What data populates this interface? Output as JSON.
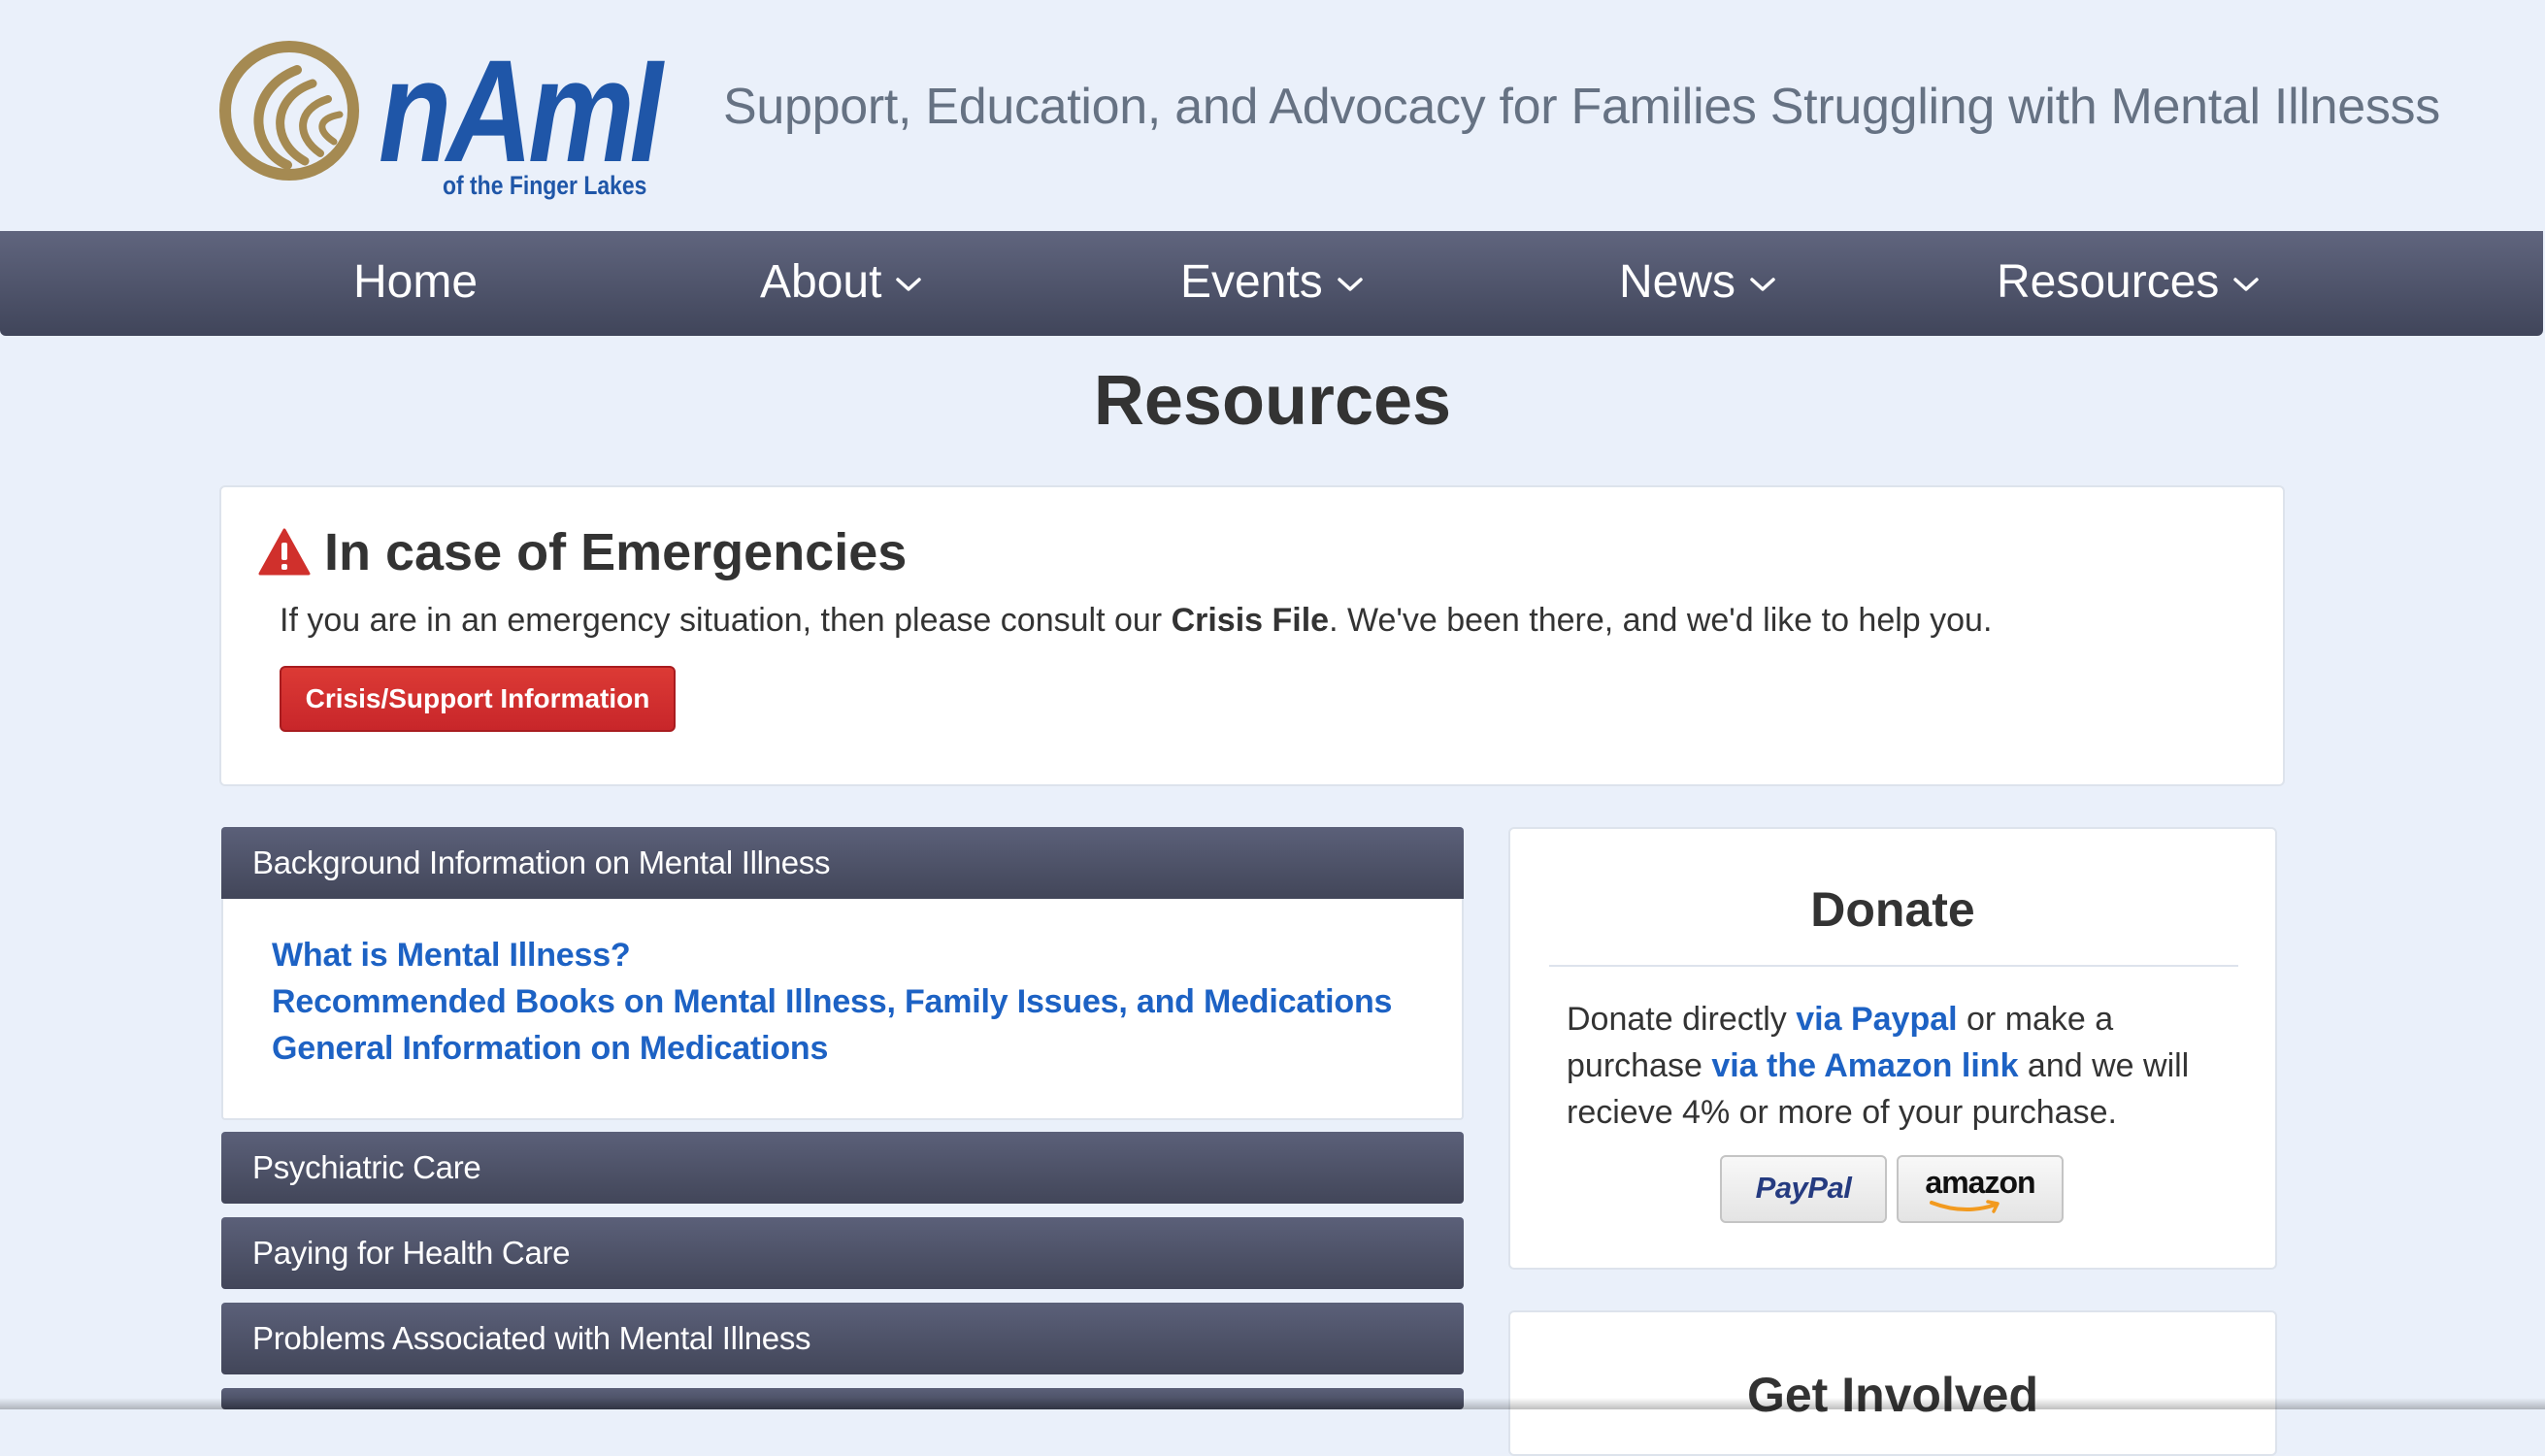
{
  "header": {
    "logo_word": "nAmI",
    "logo_sub": "of the Finger Lakes",
    "tagline": "Support, Education, and Advocacy for Families Struggling with Mental Illnesss"
  },
  "nav": {
    "items": [
      {
        "label": "Home",
        "has_dropdown": false
      },
      {
        "label": "About",
        "has_dropdown": true
      },
      {
        "label": "Events",
        "has_dropdown": true
      },
      {
        "label": "News",
        "has_dropdown": true
      },
      {
        "label": "Resources",
        "has_dropdown": true
      }
    ]
  },
  "page": {
    "title": "Resources"
  },
  "emergency": {
    "heading": "In case of Emergencies",
    "text_before": "If you are in an emergency situation, then please consult our ",
    "text_bold": "Crisis File",
    "text_after": ". We've been there, and we'd like to help you.",
    "button_label": "Crisis/Support Information",
    "icon": "warning-icon"
  },
  "accordion": {
    "open_panel": {
      "title": "Background Information on Mental Illness",
      "links": [
        "What is Mental Illness?",
        "Recommended Books on Mental Illness, Family Issues, and Medications",
        "General Information on Medications"
      ]
    },
    "closed_panels": [
      "Psychiatric Care",
      "Paying for Health Care",
      "Problems Associated with Mental Illness"
    ]
  },
  "donate": {
    "title": "Donate",
    "text_1": "Donate directly ",
    "link_paypal": "via Paypal",
    "text_2": " or make a purchase ",
    "link_amazon": "via the Amazon link",
    "text_3": " and we will recieve 4% or more of your purchase.",
    "paypal_button": "PayPal",
    "amazon_button": "amazon"
  },
  "get_involved": {
    "title": "Get Involved"
  },
  "colors": {
    "page_bg": "#eaf0fa",
    "nav_bg": "#4f5469",
    "brand_blue": "#1f56a8",
    "logo_gold": "#a58a52",
    "link_blue": "#1d62c4",
    "danger_red": "#d0302c"
  }
}
